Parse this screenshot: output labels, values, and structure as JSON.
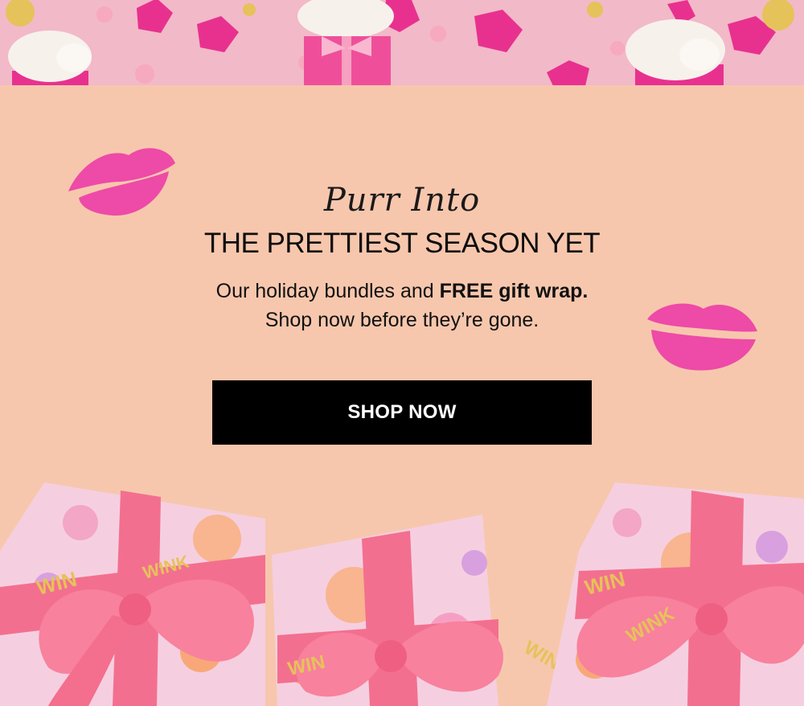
{
  "banner": {
    "icons": [
      "sleeping-cat-icon",
      "gift-box-icon",
      "floral-leaf-icon"
    ],
    "colors": {
      "pink_bg": "#f2b9c8",
      "magenta": "#e8318f",
      "gold": "#e4c45e"
    }
  },
  "hero": {
    "script_title": "Purr Into",
    "main_title": "THE PRETTIEST SEASON YET",
    "body_line1_pre": "Our holiday bundles and ",
    "body_line1_bold": "FREE gift wrap.",
    "body_line2": "Shop now before they’re gone."
  },
  "cta": {
    "label": "SHOP NOW"
  },
  "gifts": {
    "ribbon_text": "WINK",
    "ribbon_text_partial": "WIN",
    "colors": {
      "ribbon": "#f36f8f",
      "paper": "#f5cfe0"
    }
  },
  "theme": {
    "background": "#f7c7ad",
    "button_bg": "#000000",
    "kiss": "#ee4aa7"
  }
}
